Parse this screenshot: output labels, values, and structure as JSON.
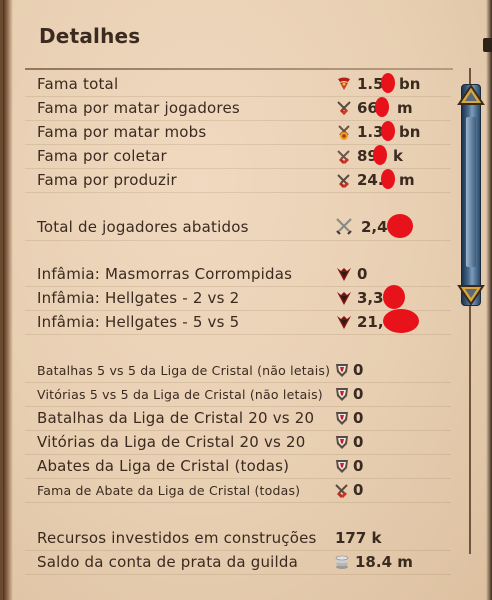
{
  "title": "Detalhes",
  "rows": [
    {
      "label": "Fama total",
      "icon": "fame-total-icon",
      "value": "1.5",
      "suffix": "bn"
    },
    {
      "label": "Fama por matar jogadores",
      "icon": "pvp-fame-icon",
      "value": "66",
      "suffix": "m"
    },
    {
      "label": "Fama por matar mobs",
      "icon": "pve-fame-icon",
      "value": "1.3",
      "suffix": "bn"
    },
    {
      "label": "Fama por coletar",
      "icon": "gathering-fame-icon",
      "value": "89",
      "suffix": "k"
    },
    {
      "label": "Fama por produzir",
      "icon": "crafting-fame-icon",
      "value": "24.",
      "suffix": "m"
    },
    {
      "label": "Total de jogadores abatidos",
      "icon": "crossed-swords-icon",
      "value": "2,4",
      "suffix": ""
    },
    {
      "label": "Infâmia: Masmorras Corrompidas",
      "icon": "infamy-icon",
      "value": "0",
      "suffix": ""
    },
    {
      "label": "Infâmia: Hellgates - 2 vs 2",
      "icon": "infamy-icon",
      "value": "3,3",
      "suffix": ""
    },
    {
      "label": "Infâmia: Hellgates - 5 vs 5",
      "icon": "infamy-icon",
      "value": "21,",
      "suffix": ""
    },
    {
      "label": "Batalhas 5 vs 5 da Liga de Cristal (não letais)",
      "icon": "crystal-shield-icon",
      "value": "0",
      "suffix": ""
    },
    {
      "label": "Vitórias 5 vs 5 da Liga de Cristal (não letais)",
      "icon": "crystal-shield-icon",
      "value": "0",
      "suffix": ""
    },
    {
      "label": "Batalhas da Liga de Cristal 20 vs 20",
      "icon": "crystal-shield-icon",
      "value": "0",
      "suffix": ""
    },
    {
      "label": "Vitórias da Liga de Cristal 20 vs 20",
      "icon": "crystal-shield-icon",
      "value": "0",
      "suffix": ""
    },
    {
      "label": "Abates da Liga de Cristal (todas)",
      "icon": "crystal-shield-icon",
      "value": "0",
      "suffix": ""
    },
    {
      "label": "Fama de Abate da Liga de Cristal (todas)",
      "icon": "crystal-fame-icon",
      "value": "0",
      "suffix": ""
    },
    {
      "label": "Recursos investidos em construções",
      "icon": "",
      "value": "177 k",
      "suffix": ""
    },
    {
      "label": "Saldo da conta de prata da guilda",
      "icon": "silver-coins-icon",
      "value": "18.4 m",
      "suffix": ""
    }
  ],
  "colors": {
    "redaction": "#e8121a",
    "scroll_thumb": "#46688a",
    "panel": "#ecd4b8"
  }
}
